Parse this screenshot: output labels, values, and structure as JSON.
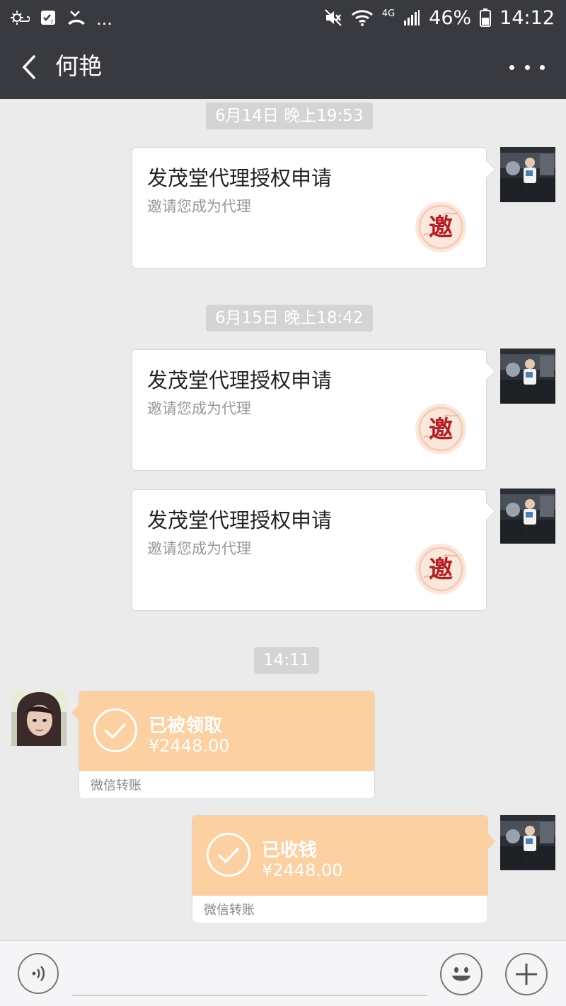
{
  "status_bar": {
    "icons_left": [
      "weather-icon",
      "sim-icon",
      "missed-call-icon",
      "more-notifications-icon"
    ],
    "more": "...",
    "network": "4G",
    "battery": "46%",
    "time": "14:12",
    "icons_right": [
      "mute-icon",
      "wifi-icon",
      "signal-icon",
      "battery-icon"
    ]
  },
  "header": {
    "title": "何艳",
    "back_icon": "chevron-left-icon",
    "menu_icon": "more-icon"
  },
  "messages": [
    {
      "type": "timestamp",
      "text": "6月14日 晚上19:53"
    },
    {
      "type": "invite",
      "side": "right",
      "title": "发茂堂代理授权申请",
      "subtitle": "邀请您成为代理",
      "seal": "邀"
    },
    {
      "type": "timestamp",
      "text": "6月15日 晚上18:42"
    },
    {
      "type": "invite",
      "side": "right",
      "title": "发茂堂代理授权申请",
      "subtitle": "邀请您成为代理",
      "seal": "邀"
    },
    {
      "type": "invite",
      "side": "right",
      "title": "发茂堂代理授权申请",
      "subtitle": "邀请您成为代理",
      "seal": "邀"
    },
    {
      "type": "timestamp",
      "text": "14:11"
    },
    {
      "type": "transfer",
      "side": "left",
      "status": "已被领取",
      "amount": "¥2448.00",
      "label": "微信转账"
    },
    {
      "type": "transfer",
      "side": "right",
      "status": "已收钱",
      "amount": "¥2448.00",
      "label": "微信转账"
    }
  ],
  "input_bar": {
    "voice_icon": "voice-icon",
    "emoji_icon": "emoji-icon",
    "plus_icon": "plus-icon"
  },
  "colors": {
    "header_bg": "#393a3f",
    "chat_bg": "#ebebeb",
    "transfer_orange": "#fcd0a0",
    "timestamp_bg": "#d4d4d4",
    "seal_red": "#b81c22"
  }
}
